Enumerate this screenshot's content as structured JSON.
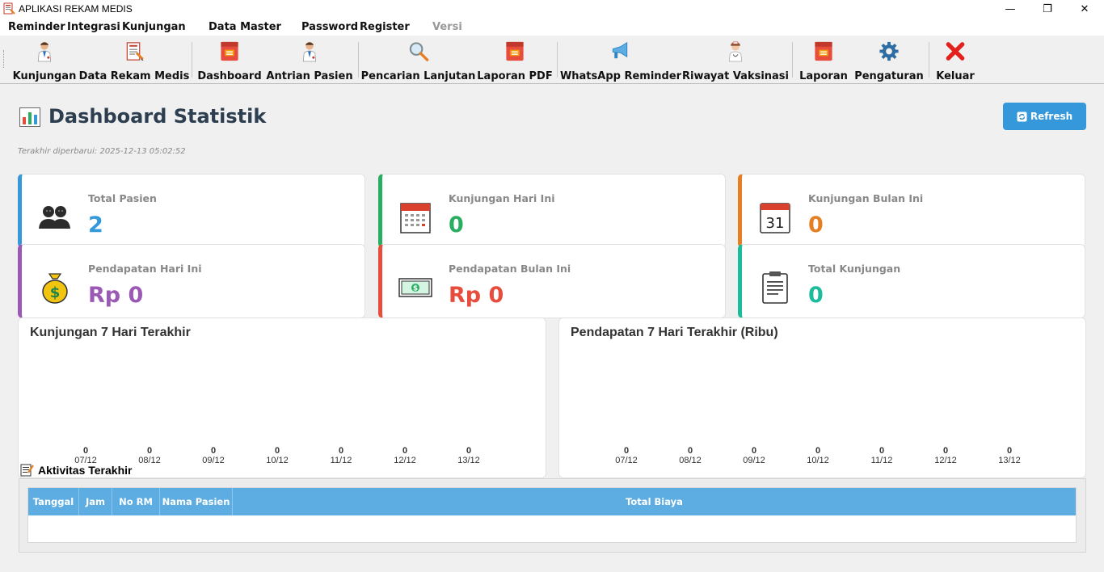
{
  "window": {
    "title": "APLIKASI REKAM MEDIS",
    "minimize": "—",
    "maximize": "❐",
    "close": "✕"
  },
  "menu": [
    "Reminder",
    "Integrasi",
    "Kunjungan",
    "Data Master",
    "Password",
    "Register",
    "Versi"
  ],
  "toolbar": [
    {
      "label": "Kunjungan",
      "icon": "doctor-icon"
    },
    {
      "label": "Data Rekam Medis",
      "icon": "medical-record-icon"
    },
    {
      "label": "Dashboard",
      "icon": "report-book-icon"
    },
    {
      "label": "Antrian Pasien",
      "icon": "doctor-icon"
    },
    {
      "label": "Pencarian Lanjutan",
      "icon": "magnifier-icon"
    },
    {
      "label": "Laporan PDF",
      "icon": "report-book-icon"
    },
    {
      "label": "WhatsApp Reminder",
      "icon": "megaphone-icon"
    },
    {
      "label": "Riwayat Vaksinasi",
      "icon": "nurse-icon"
    },
    {
      "label": "Laporan",
      "icon": "report-book-icon"
    },
    {
      "label": "Pengaturan",
      "icon": "gear-icon"
    },
    {
      "label": "Keluar",
      "icon": "red-x-icon"
    }
  ],
  "dashboard": {
    "title": "Dashboard Statistik",
    "last_updated": "Terakhir diperbarui: 2025-12-13 05:02:52",
    "refresh_label": "Refresh"
  },
  "stats": [
    {
      "label": "Total Pasien",
      "value": "2",
      "color": "#3498db",
      "icon": "patients-icon"
    },
    {
      "label": "Kunjungan Hari Ini",
      "value": "0",
      "color": "#27ae60",
      "icon": "calendar-icon"
    },
    {
      "label": "Kunjungan Bulan Ini",
      "value": "0",
      "color": "#e67e22",
      "icon": "calendar-31-icon"
    },
    {
      "label": "Pendapatan Hari Ini",
      "value": "Rp 0",
      "color": "#9b59b6",
      "icon": "money-bag-icon"
    },
    {
      "label": "Pendapatan Bulan Ini",
      "value": "Rp 0",
      "color": "#e74c3c",
      "icon": "banknote-icon"
    },
    {
      "label": "Total Kunjungan",
      "value": "0",
      "color": "#1abc9c",
      "icon": "clipboard-icon"
    }
  ],
  "chart_data": [
    {
      "type": "bar",
      "title": "Kunjungan 7 Hari Terakhir",
      "categories": [
        "07/12",
        "08/12",
        "09/12",
        "10/12",
        "11/12",
        "12/12",
        "13/12"
      ],
      "values": [
        0,
        0,
        0,
        0,
        0,
        0,
        0
      ],
      "xlabel": "",
      "ylabel": ""
    },
    {
      "type": "bar",
      "title": "Pendapatan 7 Hari Terakhir (Ribu)",
      "categories": [
        "07/12",
        "08/12",
        "09/12",
        "10/12",
        "11/12",
        "12/12",
        "13/12"
      ],
      "values": [
        0,
        0,
        0,
        0,
        0,
        0,
        0
      ],
      "xlabel": "",
      "ylabel": ""
    }
  ],
  "activity": {
    "title": "Aktivitas Terakhir",
    "columns": [
      "Tanggal",
      "Jam",
      "No RM",
      "Nama Pasien",
      "Total Biaya"
    ],
    "rows": []
  }
}
